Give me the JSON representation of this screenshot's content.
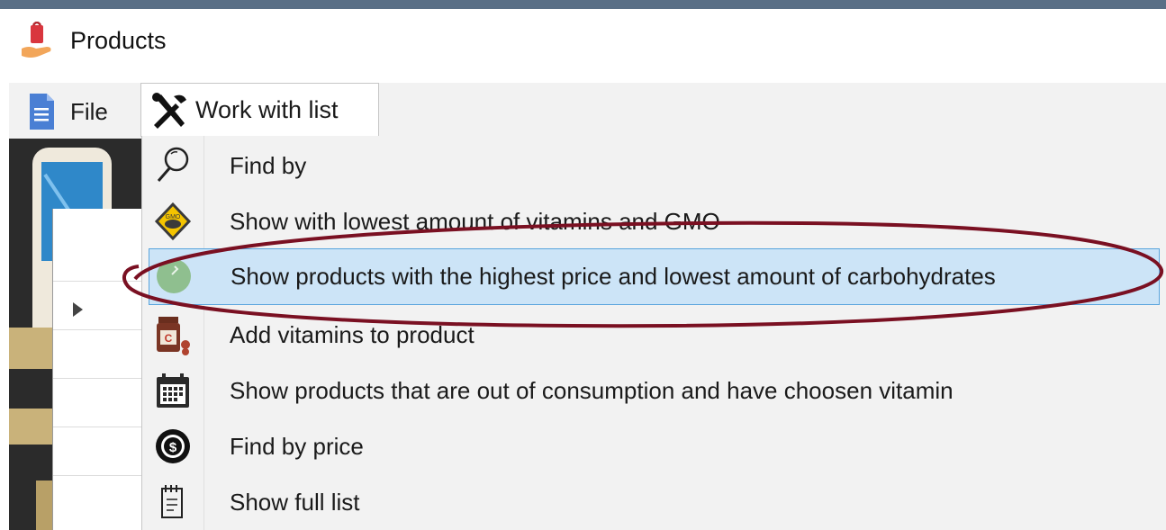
{
  "window": {
    "title": "Products"
  },
  "menubar": {
    "file_label": "File",
    "work_label": "Work with list"
  },
  "dropdown": {
    "items": [
      {
        "label": "Find by",
        "icon": "magnifier-icon"
      },
      {
        "label": "Show with lowest amount of vitamins and GMO",
        "icon": "gmo-warning-icon"
      },
      {
        "label": "Show products with the highest price and lowest amount of carbohydrates",
        "icon": "green-circle-icon",
        "selected": true
      },
      {
        "label": "Add vitamins to product",
        "icon": "vitamin-bottle-icon"
      },
      {
        "label": "Show products that are out of consumption and have choosen vitamin",
        "icon": "calendar-icon"
      },
      {
        "label": "Find by price",
        "icon": "dollar-coin-icon"
      },
      {
        "label": "Show full list",
        "icon": "notepad-icon"
      }
    ]
  },
  "colors": {
    "selection_fill": "#cce4f7",
    "selection_border": "#5aa5dd",
    "annotation_ellipse": "#7a1022",
    "menu_bg": "#f2f2f2"
  }
}
